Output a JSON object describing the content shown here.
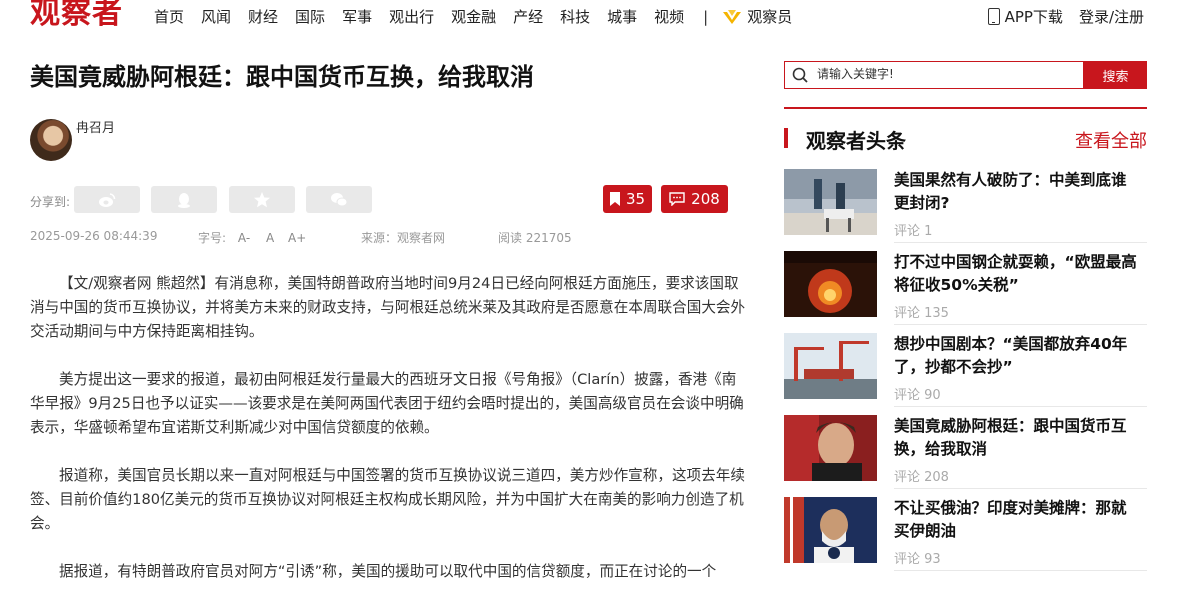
{
  "site": {
    "logo": "观察者"
  },
  "nav": {
    "items": [
      "首页",
      "风闻",
      "财经",
      "国际",
      "军事",
      "观出行",
      "观金融",
      "产经",
      "科技",
      "城事",
      "视频"
    ],
    "separator": "|",
    "vip_label": "观察员"
  },
  "header_right": {
    "app_download": "APP下载",
    "login": "登录/注册"
  },
  "article": {
    "title": "美国竟威胁阿根廷：跟中国货币互换，给我取消",
    "author": "冉召月",
    "share_label": "分享到:",
    "bookmark_count": "35",
    "comment_count": "208",
    "date": "2025-09-26 08:44:39",
    "font_size_label": "字号:",
    "font_small": "A-",
    "font_normal": "A",
    "font_large": "A+",
    "source": "来源：观察者网",
    "reads": "阅读 221705",
    "paragraphs": [
      "【文/观察者网 熊超然】有消息称，美国特朗普政府当地时间9月24日已经向阿根廷方面施压，要求该国取消与中国的货币互换协议，并将美方未来的财政支持，与阿根廷总统米莱及其政府是否愿意在本周联合国大会外交活动期间与中方保持距离相挂钩。",
      "美方提出这一要求的报道，最初由阿根廷发行量最大的西班牙文日报《号角报》（Clarín）披露，香港《南华早报》9月25日也予以证实——该要求是在美阿两国代表团于纽约会晤时提出的，美国高级官员在会谈中明确表示，华盛顿希望布宜诺斯艾利斯减少对中国信贷额度的依赖。",
      "报道称，美国官员长期以来一直对阿根廷与中国签署的货币互换协议说三道四，美方炒作宣称，这项去年续签、目前价值约180亿美元的货币互换协议对阿根廷主权构成长期风险，并为中国扩大在南美的影响力创造了机会。",
      "据报道，有特朗普政府官员对阿方“引诱”称，美国的援助可以取代中国的信贷额度，而正在讨论的一个"
    ]
  },
  "sidebar": {
    "search_placeholder": "请输入关键字!",
    "search_button": "搜索",
    "section_title": "观察者头条",
    "view_all": "查看全部",
    "news": [
      {
        "headline": "美国果然有人破防了：中美到底谁更封闭?",
        "comments": "评论 1"
      },
      {
        "headline": "打不过中国钢企就耍赖，“欧盟最高将征收50%关税”",
        "comments": "评论 135"
      },
      {
        "headline": "想抄中国剧本？“美国都放弃40年了，抄都不会抄”",
        "comments": "评论 90"
      },
      {
        "headline": "美国竟威胁阿根廷：跟中国货币互换，给我取消",
        "comments": "评论 208"
      },
      {
        "headline": "不让买俄油？印度对美摊牌：那就买伊朗油",
        "comments": "评论 93"
      }
    ]
  }
}
